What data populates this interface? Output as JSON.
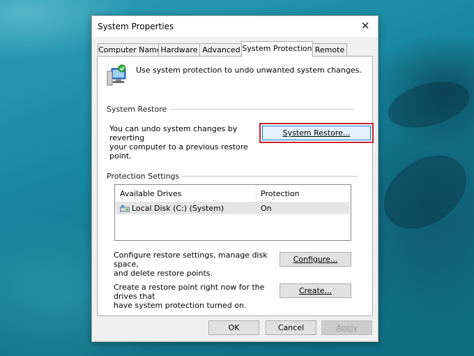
{
  "dialog": {
    "title": "System Properties",
    "close_glyph": "✕"
  },
  "tabs": [
    {
      "label": "Computer Name",
      "active": false
    },
    {
      "label": "Hardware",
      "active": false
    },
    {
      "label": "Advanced",
      "active": false
    },
    {
      "label": "System Protection",
      "active": true
    },
    {
      "label": "Remote",
      "active": false
    }
  ],
  "intro": {
    "icon": "system-protection-icon",
    "text": "Use system protection to undo unwanted system changes."
  },
  "system_restore": {
    "group_label": "System Restore",
    "description_line1": "You can undo system changes by reverting",
    "description_line2": "your computer to a previous restore point.",
    "button_label": "System Restore..."
  },
  "protection_settings": {
    "group_label": "Protection Settings",
    "columns": [
      "Available Drives",
      "Protection"
    ],
    "rows": [
      {
        "drive": "Local Disk (C:) (System)",
        "protection": "On",
        "icon": "drive-icon"
      }
    ]
  },
  "configure": {
    "description_line1": "Configure restore settings, manage disk space,",
    "description_line2": "and delete restore points.",
    "button_label": "Configure..."
  },
  "create": {
    "description_line1": "Create a restore point right now for the drives that",
    "description_line2": "have system protection turned on.",
    "button_label": "Create..."
  },
  "footer": {
    "ok_label": "OK",
    "cancel_label": "Cancel",
    "apply_label": "Apply"
  },
  "colors": {
    "highlight_border": "#c8202c",
    "focus_border": "#0078d7"
  }
}
